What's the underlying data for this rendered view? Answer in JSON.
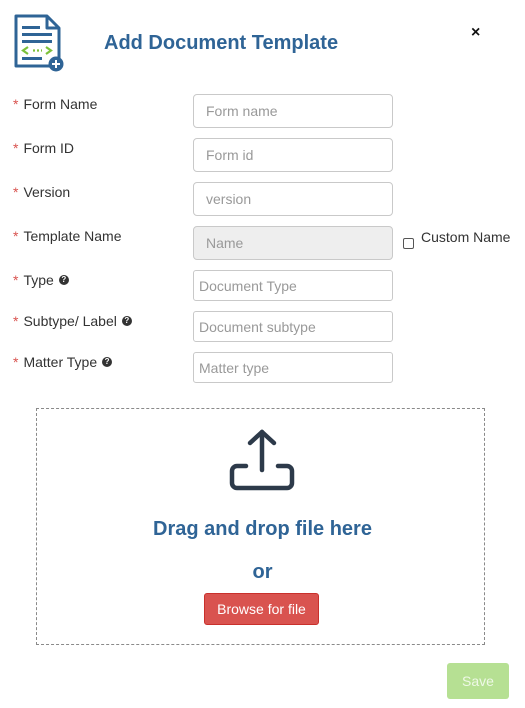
{
  "dialog": {
    "title": "Add Document Template",
    "close_symbol": "×",
    "header_icon": "document-template-add-icon"
  },
  "fields": {
    "form_name": {
      "label": "Form Name",
      "placeholder": "Form name",
      "value": ""
    },
    "form_id": {
      "label": "Form ID",
      "placeholder": "Form id",
      "value": ""
    },
    "version": {
      "label": "Version",
      "placeholder": "version",
      "value": ""
    },
    "template_name": {
      "label": "Template Name",
      "placeholder": "Name",
      "value": "",
      "disabled": true
    },
    "custom_name": {
      "label": "Custom Name",
      "checked": false
    },
    "type": {
      "label": "Type",
      "placeholder": "Document Type",
      "value": ""
    },
    "subtype": {
      "label": "Subtype/ Label",
      "placeholder": "Document subtype",
      "value": ""
    },
    "matter_type": {
      "label": "Matter Type",
      "placeholder": "Matter type",
      "value": ""
    }
  },
  "required_mark": "*",
  "help_symbol": "?",
  "upload": {
    "icon": "upload-tray-icon",
    "drag_text": "Drag and drop file here",
    "or_text": "or",
    "browse_label": "Browse for file"
  },
  "footer": {
    "save_label": "Save"
  },
  "colors": {
    "title": "#2f6496",
    "required": "#d9534f",
    "browse_button": "#d9534f",
    "save_button_disabled": "#b6e093"
  }
}
